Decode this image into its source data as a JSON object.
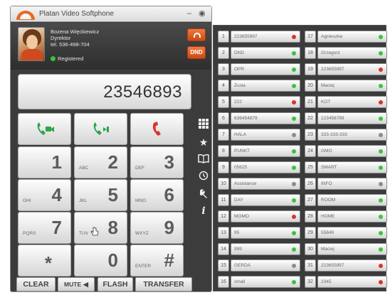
{
  "app": {
    "title": "Platan Video Softphone",
    "minimize_glyph": "–",
    "close_glyph": "◉"
  },
  "user": {
    "name": "Bozena Więckiewicz",
    "role": "Dyrektor",
    "phone": "tel. 536-498-704",
    "status": "Registered",
    "status_color": "#39c43b",
    "dnd_label": "DND"
  },
  "display": {
    "number": "23546893"
  },
  "keypad": {
    "keys": [
      {
        "digit": "1",
        "letters": ""
      },
      {
        "digit": "2",
        "letters": "ABC"
      },
      {
        "digit": "3",
        "letters": "DEF"
      },
      {
        "digit": "4",
        "letters": "GHI"
      },
      {
        "digit": "5",
        "letters": "JKL"
      },
      {
        "digit": "6",
        "letters": "MNO"
      },
      {
        "digit": "7",
        "letters": "PQRS"
      },
      {
        "digit": "8",
        "letters": "TUV"
      },
      {
        "digit": "9",
        "letters": "WXYZ"
      },
      {
        "digit": "*",
        "letters": ""
      },
      {
        "digit": "0",
        "letters": ""
      },
      {
        "digit": "#",
        "letters": "ENTER"
      }
    ]
  },
  "side_icons": [
    "grid-icon",
    "star-icon",
    "book-icon",
    "history-icon",
    "wrench-icon",
    "info-icon"
  ],
  "bottom": {
    "clear": "CLEAR",
    "mute": "MUTE",
    "flash": "FLASH",
    "transfer": "TRANSFER"
  },
  "colors": {
    "accent": "#e46a28",
    "green": "#39c43b",
    "red": "#d9342b",
    "gray": "#8c8c8c"
  },
  "speed_dial": [
    {
      "n": "1",
      "name": "223655997",
      "led": "red"
    },
    {
      "n": "2",
      "name": "DND",
      "led": "green"
    },
    {
      "n": "3",
      "name": "OPR",
      "led": "green"
    },
    {
      "n": "4",
      "name": "Zusia",
      "led": "green"
    },
    {
      "n": "5",
      "name": "222",
      "led": "red"
    },
    {
      "n": "6",
      "name": "636454879",
      "led": "green"
    },
    {
      "n": "7",
      "name": "HALA",
      "led": "gray"
    },
    {
      "n": "8",
      "name": "PUNKT",
      "led": "green"
    },
    {
      "n": "9",
      "name": "05625",
      "led": "green"
    },
    {
      "n": "10",
      "name": "Assistance",
      "led": "gray"
    },
    {
      "n": "11",
      "name": "DAY",
      "led": "green"
    },
    {
      "n": "12",
      "name": "MOMO",
      "led": "red"
    },
    {
      "n": "13",
      "name": "95",
      "led": "green"
    },
    {
      "n": "14",
      "name": "999",
      "led": "green"
    },
    {
      "n": "15",
      "name": "GERDA",
      "led": "gray"
    },
    {
      "n": "16",
      "name": "small",
      "led": "green"
    },
    {
      "n": "17",
      "name": "Agnieszka",
      "led": "green"
    },
    {
      "n": "18",
      "name": "Grzegorz",
      "led": "green"
    },
    {
      "n": "19",
      "name": "223655997",
      "led": "red"
    },
    {
      "n": "20",
      "name": "Maciej",
      "led": "green"
    },
    {
      "n": "21",
      "name": "KOT",
      "led": "red"
    },
    {
      "n": "22",
      "name": "123456789",
      "led": "green"
    },
    {
      "n": "23",
      "name": "333-333-333",
      "led": "gray"
    },
    {
      "n": "24",
      "name": "GMO",
      "led": "green"
    },
    {
      "n": "25",
      "name": "SMART",
      "led": "green"
    },
    {
      "n": "26",
      "name": "INFO",
      "led": "gray"
    },
    {
      "n": "27",
      "name": "ROOM",
      "led": "green"
    },
    {
      "n": "28",
      "name": "HOME",
      "led": "green"
    },
    {
      "n": "29",
      "name": "55849",
      "led": "green"
    },
    {
      "n": "30",
      "name": "Maciej",
      "led": "green"
    },
    {
      "n": "31",
      "name": "223655997",
      "led": "red"
    },
    {
      "n": "32",
      "name": "2345",
      "led": "red"
    }
  ]
}
